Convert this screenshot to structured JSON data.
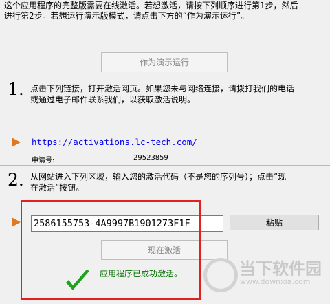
{
  "intro": {
    "line1": "这个应用程序的完整版需要在线激活。若想激活，请按下列顺序进行第1步，然后",
    "line2": "进行第2步。若想运行演示版模式，请点击下方的“作为演示运行”。"
  },
  "demo_button": {
    "label": "作为演示运行"
  },
  "step1": {
    "number": "1.",
    "line1": "点击下列链接，打开激活网页。如果您未与网络连接，请拨打我们的电话",
    "line2": "或通过电子邮件联系我们，以获取激活说明。",
    "link": "https://activations.lc-tech.com/",
    "request_label": "申请号:",
    "request_value": "29523859"
  },
  "step2": {
    "number": "2.",
    "line1": "从网站进入下列区域，输入您的激活代码（不是您的序列号）；点击“现",
    "line2": "在激活”按钮。",
    "code_value": "2586155753-4A9997B1901273F1F",
    "paste_label": "粘贴",
    "activate_label": "现在激活",
    "success_text": "应用程序已成功激活。"
  },
  "watermark": {
    "title": "当下软件园",
    "url": "www.downxia.com"
  },
  "colors": {
    "arrow": "#e07820",
    "highlight_box": "#e22020",
    "check": "#1fa31f",
    "success_text": "#007000"
  }
}
